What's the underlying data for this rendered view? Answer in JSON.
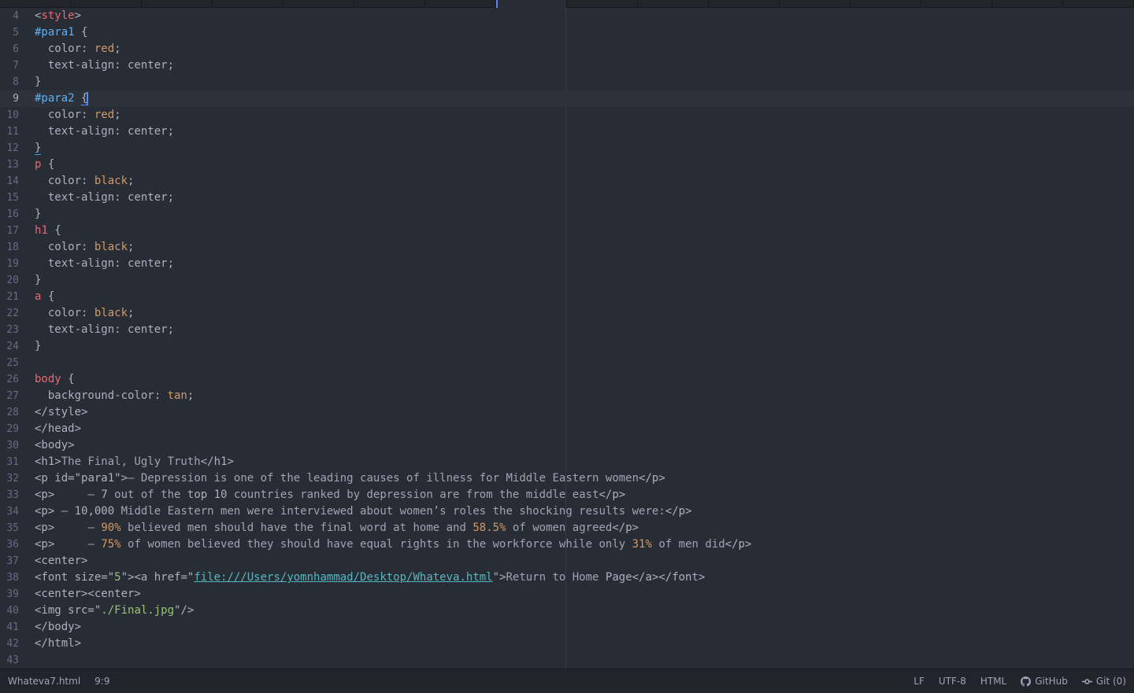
{
  "editor": {
    "file_name": "Whateva7.html",
    "cursor_position": "9:9",
    "lines": [
      {
        "n": "4",
        "segs": [
          [
            "tg",
            "<"
          ],
          [
            "tn",
            "style"
          ],
          [
            "tg",
            ">"
          ]
        ]
      },
      {
        "n": "5",
        "segs": [
          [
            "id",
            "#para1"
          ],
          [
            "tx",
            " {"
          ]
        ]
      },
      {
        "n": "6",
        "segs": [
          [
            "pr",
            "  color: "
          ],
          [
            "vl",
            "red"
          ],
          [
            "tx",
            ";"
          ]
        ]
      },
      {
        "n": "7",
        "segs": [
          [
            "pr",
            "  text-align: center;"
          ]
        ]
      },
      {
        "n": "8",
        "segs": [
          [
            "tx",
            "}"
          ]
        ]
      },
      {
        "n": "9",
        "segs": [
          [
            "id",
            "#para2"
          ],
          [
            "tx",
            " "
          ],
          [
            "bm",
            "{"
          ],
          [
            "cur",
            ""
          ]
        ],
        "cursor": true
      },
      {
        "n": "10",
        "segs": [
          [
            "pr",
            "  color: "
          ],
          [
            "vl",
            "red"
          ],
          [
            "tx",
            ";"
          ]
        ]
      },
      {
        "n": "11",
        "segs": [
          [
            "pr",
            "  text-align: center;"
          ]
        ]
      },
      {
        "n": "12",
        "segs": [
          [
            "bm",
            "}"
          ]
        ]
      },
      {
        "n": "13",
        "segs": [
          [
            "tn",
            "p"
          ],
          [
            "tx",
            " {"
          ]
        ]
      },
      {
        "n": "14",
        "segs": [
          [
            "pr",
            "  color: "
          ],
          [
            "vl",
            "black"
          ],
          [
            "tx",
            ";"
          ]
        ]
      },
      {
        "n": "15",
        "segs": [
          [
            "pr",
            "  text-align: center;"
          ]
        ]
      },
      {
        "n": "16",
        "segs": [
          [
            "tx",
            "}"
          ]
        ]
      },
      {
        "n": "17",
        "segs": [
          [
            "tn",
            "h1"
          ],
          [
            "tx",
            " {"
          ]
        ]
      },
      {
        "n": "18",
        "segs": [
          [
            "pr",
            "  color: "
          ],
          [
            "vl",
            "black"
          ],
          [
            "tx",
            ";"
          ]
        ]
      },
      {
        "n": "19",
        "segs": [
          [
            "pr",
            "  text-align: center;"
          ]
        ]
      },
      {
        "n": "20",
        "segs": [
          [
            "tx",
            "}"
          ]
        ]
      },
      {
        "n": "21",
        "segs": [
          [
            "tn",
            "a"
          ],
          [
            "tx",
            " {"
          ]
        ]
      },
      {
        "n": "22",
        "segs": [
          [
            "pr",
            "  color: "
          ],
          [
            "vl",
            "black"
          ],
          [
            "tx",
            ";"
          ]
        ]
      },
      {
        "n": "23",
        "segs": [
          [
            "pr",
            "  text-align: center;"
          ]
        ]
      },
      {
        "n": "24",
        "segs": [
          [
            "tx",
            "}"
          ]
        ]
      },
      {
        "n": "25",
        "segs": []
      },
      {
        "n": "26",
        "segs": [
          [
            "tn",
            "body"
          ],
          [
            "tx",
            " {"
          ]
        ]
      },
      {
        "n": "27",
        "segs": [
          [
            "pr",
            "  background-color: "
          ],
          [
            "vl",
            "tan"
          ],
          [
            "tx",
            ";"
          ]
        ]
      },
      {
        "n": "28",
        "segs": [
          [
            "tg",
            "</style>"
          ]
        ]
      },
      {
        "n": "29",
        "segs": [
          [
            "tg",
            "</head>"
          ]
        ]
      },
      {
        "n": "30",
        "segs": [
          [
            "tg",
            "<body>"
          ]
        ]
      },
      {
        "n": "31",
        "segs": [
          [
            "tg",
            "<h1>"
          ],
          [
            "dim",
            "The Final, Ugly Truth"
          ],
          [
            "tg",
            "</h1>"
          ]
        ]
      },
      {
        "n": "32",
        "segs": [
          [
            "tg",
            "<p id=\""
          ],
          [
            "tx",
            "para1"
          ],
          [
            "tg",
            "\">"
          ],
          [
            "dim",
            "– Depression is one of the leading causes of illness for Middle Eastern women"
          ],
          [
            "tg",
            "</p>"
          ]
        ]
      },
      {
        "n": "33",
        "segs": [
          [
            "tg",
            "<p>"
          ],
          [
            "dim",
            "     – "
          ],
          [
            "tx",
            "7"
          ],
          [
            "dim",
            " out of the "
          ],
          [
            "tx",
            "top 10"
          ],
          [
            "dim",
            " countries ranked by depression are from the middle east"
          ],
          [
            "tg",
            "</p>"
          ]
        ]
      },
      {
        "n": "34",
        "segs": [
          [
            "tg",
            "<p>"
          ],
          [
            "dim",
            " – "
          ],
          [
            "tx",
            "10,000"
          ],
          [
            "dim",
            " Middle Eastern men were interviewed about women’s roles the shocking results were:"
          ],
          [
            "tg",
            "</p>"
          ]
        ]
      },
      {
        "n": "35",
        "segs": [
          [
            "tg",
            "<p>"
          ],
          [
            "dim",
            "     – "
          ],
          [
            "num",
            "90%"
          ],
          [
            "dim",
            " believed men should have the final word at home and "
          ],
          [
            "num",
            "58.5%"
          ],
          [
            "dim",
            " of women agreed"
          ],
          [
            "tg",
            "</p>"
          ]
        ]
      },
      {
        "n": "36",
        "segs": [
          [
            "tg",
            "<p>"
          ],
          [
            "dim",
            "     – "
          ],
          [
            "num",
            "75%"
          ],
          [
            "dim",
            " of women believed they should have equal rights in the workforce while only "
          ],
          [
            "num",
            "31%"
          ],
          [
            "dim",
            " of men did"
          ],
          [
            "tg",
            "</p>"
          ]
        ]
      },
      {
        "n": "37",
        "segs": [
          [
            "tg",
            "<center>"
          ]
        ]
      },
      {
        "n": "38",
        "segs": [
          [
            "tg",
            "<font size=\""
          ],
          [
            "st",
            "5"
          ],
          [
            "tg",
            "\"><a href=\""
          ],
          [
            "lk",
            "file:///Users/yomnhammad/Desktop/Whateva.html"
          ],
          [
            "tg",
            "\">"
          ],
          [
            "dim",
            "Return to Home "
          ],
          [
            "tx",
            "Page"
          ],
          [
            "tg",
            "</a></font>"
          ]
        ]
      },
      {
        "n": "39",
        "segs": [
          [
            "tg",
            "<center><center>"
          ]
        ]
      },
      {
        "n": "40",
        "segs": [
          [
            "tg",
            "<img src=\""
          ],
          [
            "st",
            "./Final.jpg"
          ],
          [
            "tg",
            "\"/>"
          ]
        ]
      },
      {
        "n": "41",
        "segs": [
          [
            "tg",
            "</body>"
          ]
        ]
      },
      {
        "n": "42",
        "segs": [
          [
            "tg",
            "</html>"
          ]
        ]
      },
      {
        "n": "43",
        "segs": []
      }
    ]
  },
  "status": {
    "line_ending": "LF",
    "encoding": "UTF-8",
    "grammar": "HTML",
    "github_label": "GitHub",
    "git_label": "Git (0)"
  },
  "icons": {
    "github": "github-icon",
    "git": "git-commit-icon"
  },
  "colors": {
    "background": "#282c34",
    "tag_name": "#e06c75",
    "selector_id": "#61afef",
    "value": "#d19a66",
    "string": "#98c379",
    "link": "#56b6c2",
    "cursor": "#528bff"
  }
}
